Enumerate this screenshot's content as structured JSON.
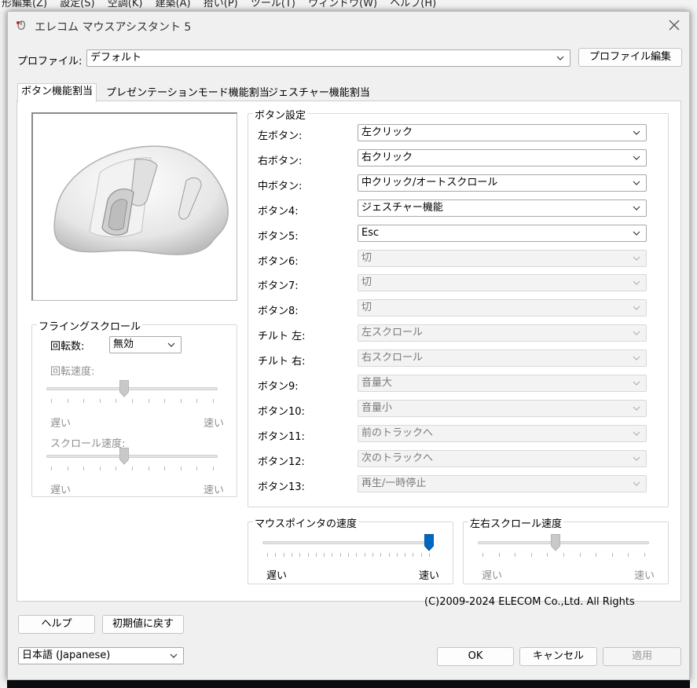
{
  "background": {
    "menu_items": [
      "形編集(Z)",
      "設定(S)",
      "空調(K)",
      "建築(A)",
      "拾い(P)",
      "ツール(T)",
      "ウィンドウ(W)",
      "ヘルプ(H)"
    ]
  },
  "window": {
    "title": "エレコム マウスアシスタント 5"
  },
  "profile": {
    "label": "プロファイル:",
    "value": "デフォルト",
    "edit_button": "プロファイル編集"
  },
  "tabs": [
    {
      "label": "ボタン機能割当",
      "active": true
    },
    {
      "label": "プレゼンテーションモード機能割当",
      "active": false
    },
    {
      "label": "ジェスチャー機能割当",
      "active": false
    }
  ],
  "button_settings": {
    "title": "ボタン設定",
    "rows": [
      {
        "label": "左ボタン:",
        "value": "左クリック",
        "enabled": true
      },
      {
        "label": "右ボタン:",
        "value": "右クリック",
        "enabled": true
      },
      {
        "label": "中ボタン:",
        "value": "中クリック/オートスクロール",
        "enabled": true
      },
      {
        "label": "ボタン4:",
        "value": "ジェスチャー機能",
        "enabled": true
      },
      {
        "label": "ボタン5:",
        "value": "Esc",
        "enabled": true
      },
      {
        "label": "ボタン6:",
        "value": "切",
        "enabled": false
      },
      {
        "label": "ボタン7:",
        "value": "切",
        "enabled": false
      },
      {
        "label": "ボタン8:",
        "value": "切",
        "enabled": false
      },
      {
        "label": "チルト 左:",
        "value": "左スクロール",
        "enabled": false
      },
      {
        "label": "チルト 右:",
        "value": "右スクロール",
        "enabled": false
      },
      {
        "label": "ボタン9:",
        "value": "音量大",
        "enabled": false
      },
      {
        "label": "ボタン10:",
        "value": "音量小",
        "enabled": false
      },
      {
        "label": "ボタン11:",
        "value": "前のトラックへ",
        "enabled": false
      },
      {
        "label": "ボタン12:",
        "value": "次のトラックへ",
        "enabled": false
      },
      {
        "label": "ボタン13:",
        "value": "再生/一時停止",
        "enabled": false
      }
    ]
  },
  "flying_scroll": {
    "title": "フライングスクロール",
    "rotations_label": "回転数:",
    "rotations_value": "無効",
    "rotation_speed_label": "回転速度:",
    "rotation_speed_level": 0.45,
    "scroll_speed_label": "スクロール速度:",
    "scroll_speed_level": 0.45,
    "slow_label": "遅い",
    "fast_label": "速い"
  },
  "pointer_speed": {
    "title": "マウスポインタの速度",
    "level": 1.0,
    "slow_label": "遅い",
    "fast_label": "速い"
  },
  "horizontal_scroll_speed": {
    "title": "左右スクロール速度",
    "level": 0.45,
    "slow_label": "遅い",
    "fast_label": "速い"
  },
  "copyright": "(C)2009-2024 ELECOM Co.,Ltd. All Rights",
  "footer": {
    "help_button": "ヘルプ",
    "reset_button": "初期値に戻す",
    "language_value": "日本語 (Japanese)",
    "ok_button": "OK",
    "cancel_button": "キャンセル",
    "apply_button": "適用"
  },
  "colors": {
    "accent": "#0067c0",
    "dialog_bg": "#f0f0f0",
    "panel_bg": "#ffffff",
    "disabled_text": "#8e8e8e"
  }
}
